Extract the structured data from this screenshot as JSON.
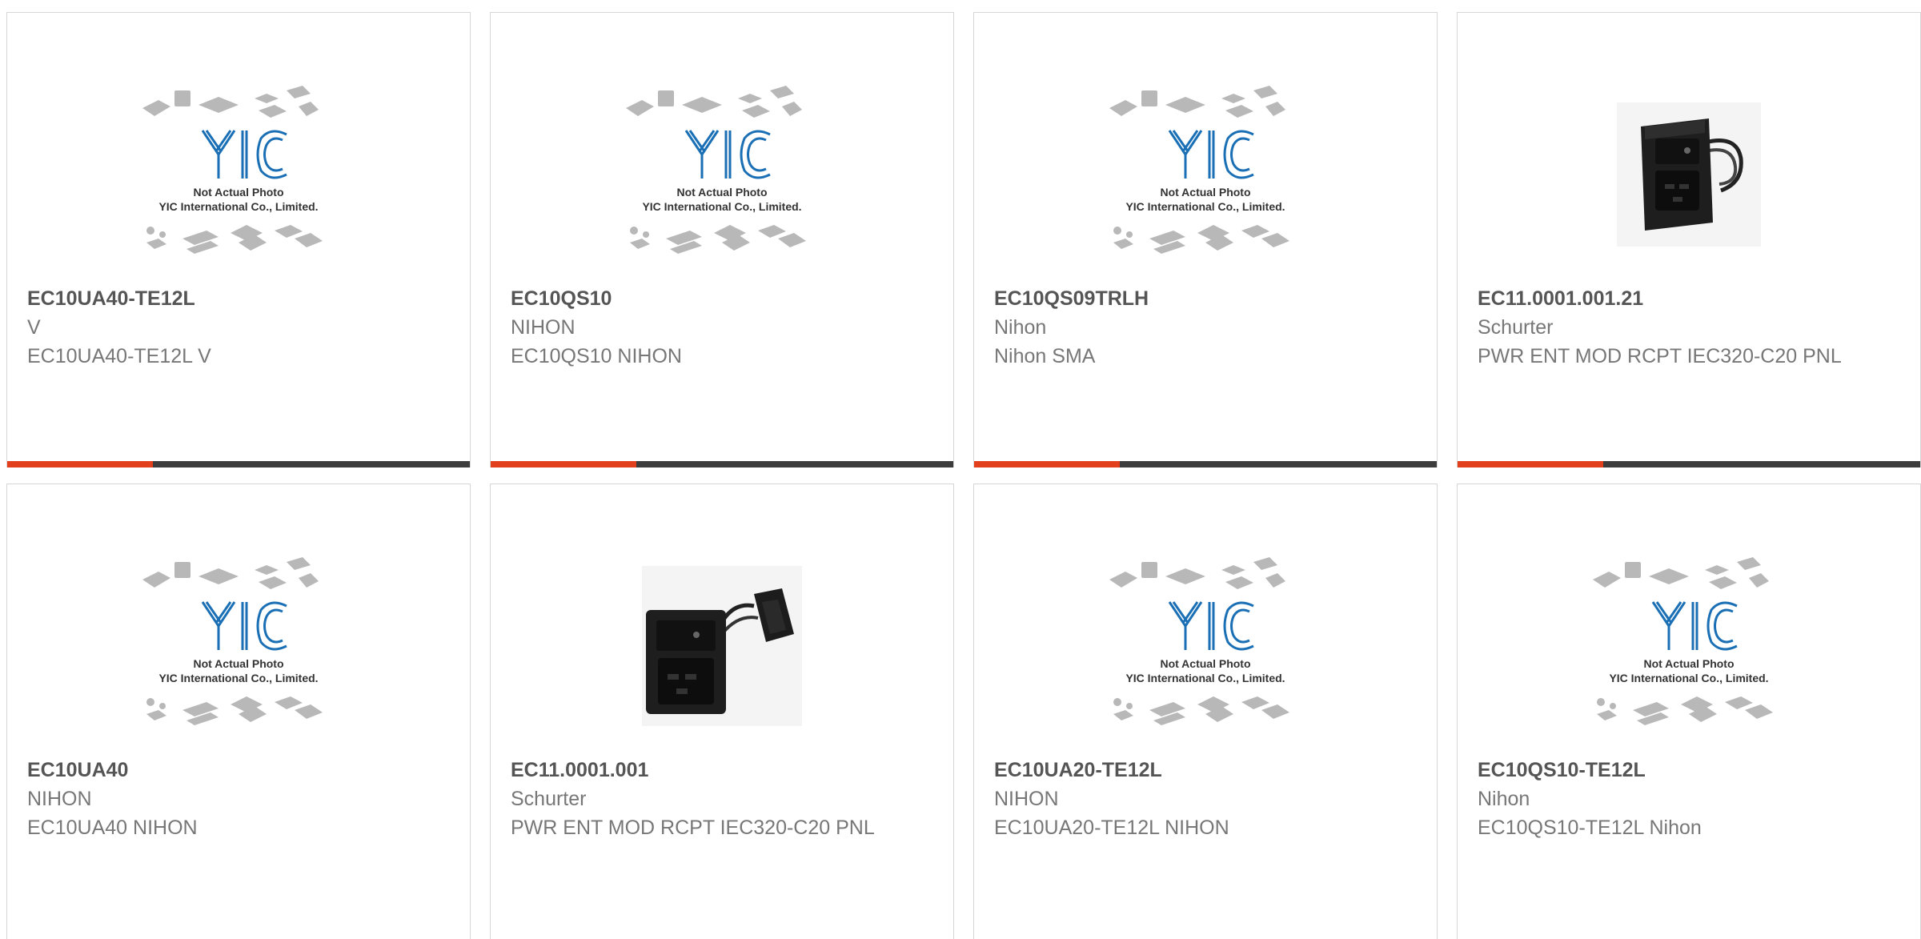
{
  "products": [
    {
      "part_number": "EC10UA40-TE12L",
      "manufacturer": "V",
      "description": "EC10UA40-TE12L V",
      "image": "yic-placeholder",
      "placeholder_line1": "Not Actual Photo",
      "placeholder_line2": "YIC International Co., Limited."
    },
    {
      "part_number": "EC10QS10",
      "manufacturer": "NIHON",
      "description": "EC10QS10 NIHON",
      "image": "yic-placeholder",
      "placeholder_line1": "Not Actual Photo",
      "placeholder_line2": "YIC International Co., Limited."
    },
    {
      "part_number": "EC10QS09TRLH",
      "manufacturer": "Nihon",
      "description": "Nihon SMA",
      "image": "yic-placeholder",
      "placeholder_line1": "Not Actual Photo",
      "placeholder_line2": "YIC International Co., Limited."
    },
    {
      "part_number": "EC11.0001.001.21",
      "manufacturer": "Schurter",
      "description": "PWR ENT MOD RCPT IEC320-C20 PNL",
      "image": "power-entry-module"
    },
    {
      "part_number": "EC10UA40",
      "manufacturer": "NIHON",
      "description": "EC10UA40 NIHON",
      "image": "yic-placeholder",
      "placeholder_line1": "Not Actual Photo",
      "placeholder_line2": "YIC International Co., Limited."
    },
    {
      "part_number": "EC11.0001.001",
      "manufacturer": "Schurter",
      "description": "PWR ENT MOD RCPT IEC320-C20 PNL",
      "image": "power-entry-module-side"
    },
    {
      "part_number": "EC10UA20-TE12L",
      "manufacturer": "NIHON",
      "description": "EC10UA20-TE12L NIHON",
      "image": "yic-placeholder",
      "placeholder_line1": "Not Actual Photo",
      "placeholder_line2": "YIC International Co., Limited."
    },
    {
      "part_number": "EC10QS10-TE12L",
      "manufacturer": "Nihon",
      "description": "EC10QS10-TE12L Nihon",
      "image": "yic-placeholder",
      "placeholder_line1": "Not Actual Photo",
      "placeholder_line2": "YIC International Co., Limited."
    }
  ],
  "colors": {
    "accent_bar": "#e2401c",
    "dark_bar": "#3d3d3d",
    "logo_blue": "#1a6fb5"
  }
}
